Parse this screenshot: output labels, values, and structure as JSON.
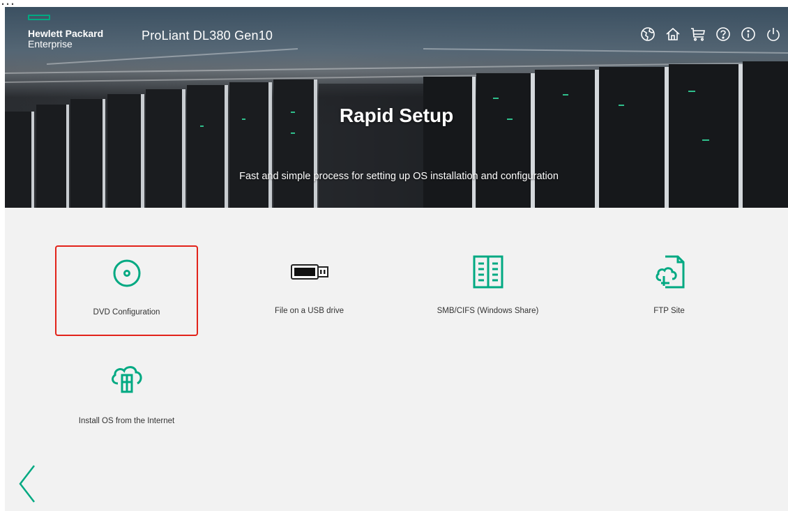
{
  "header": {
    "brand_line1": "Hewlett Packard",
    "brand_line2": "Enterprise",
    "product": "ProLiant DL380 Gen10",
    "icons": [
      "language-icon",
      "home-icon",
      "cart-icon",
      "help-icon",
      "info-icon",
      "power-icon"
    ],
    "brand_color": "#01a982"
  },
  "hero": {
    "title": "Rapid Setup",
    "subtitle": "Fast and simple process for setting up OS installation and configuration"
  },
  "options": [
    {
      "label": "DVD Configuration",
      "icon": "disc-icon",
      "selected": true
    },
    {
      "label": "File on a USB drive",
      "icon": "usb-drive-icon",
      "selected": false
    },
    {
      "label": "SMB/CIFS (Windows Share)",
      "icon": "network-share-icon",
      "selected": false
    },
    {
      "label": "FTP Site",
      "icon": "ftp-cloud-icon",
      "selected": false
    },
    {
      "label": "Install OS from the Internet",
      "icon": "internet-install-icon",
      "selected": false
    }
  ],
  "colors": {
    "accent": "#01a982",
    "selection_outline": "#e2231a",
    "background": "#f2f2f2"
  }
}
